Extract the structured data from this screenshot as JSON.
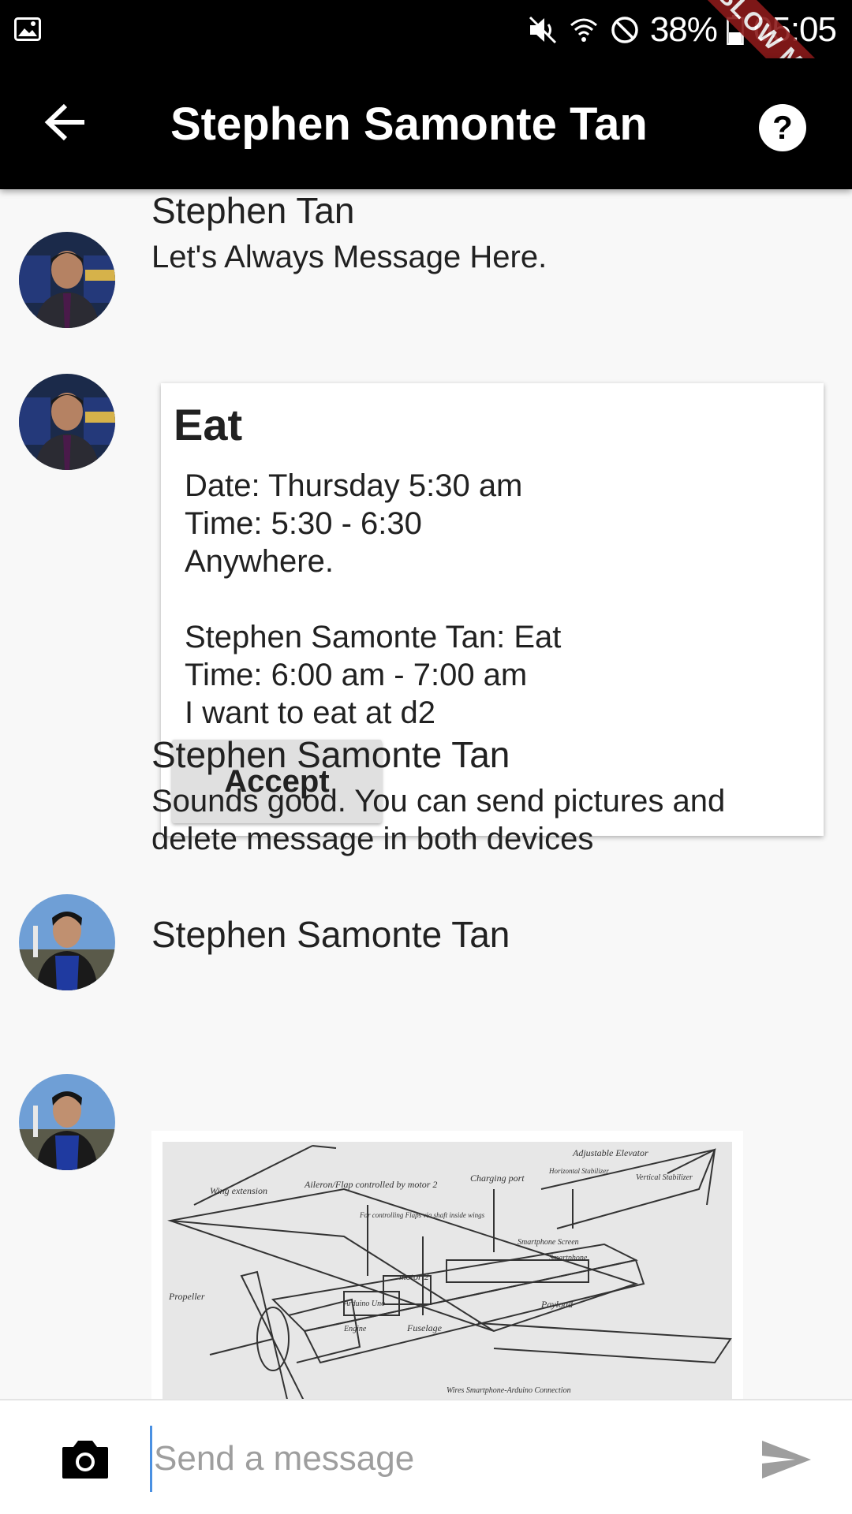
{
  "status_bar": {
    "battery": "38%",
    "time": "05:05",
    "ribbon": "SLOW MODE",
    "icons": [
      "image-icon",
      "mute-icon",
      "wifi-icon",
      "no-sim-icon",
      "battery-icon"
    ]
  },
  "app_bar": {
    "title": "Stephen Samonte Tan",
    "back_icon": "arrow-back-icon",
    "help_icon": "help-circle-icon"
  },
  "messages": [
    {
      "sender": "Stephen Tan",
      "text": "Let's Always Message Here."
    },
    {
      "sender": "",
      "card": {
        "title": "Eat",
        "lines": [
          "Date: Thursday 5:30 am",
          "Time: 5:30 - 6:30",
          "Anywhere.",
          "",
          "Stephen Samonte Tan: Eat",
          "Time: 6:00 am - 7:00 am",
          "I want to eat at d2"
        ],
        "button": "Accept"
      }
    },
    {
      "sender": "Stephen Samonte Tan",
      "text": "Sounds good. You can send pictures and delete message in both devices"
    },
    {
      "sender": "Stephen Samonte Tan",
      "image_labels": [
        "Wing extension",
        "Aileron/Flap controlled by motor 2",
        "Charging port",
        "Horizontal Stabilizer",
        "Adjustable Elevator",
        "Vertical Stabilizer",
        "For controlling Flaps via shaft inside wings",
        "Smartphone Screen",
        "Smartphone",
        "motor 2",
        "Propeller",
        "Arduino Uno",
        "Payload",
        "Engine",
        "Fuselage",
        "Wires Smartphone-Arduino Connection"
      ]
    }
  ],
  "input": {
    "placeholder": "Send a message",
    "value": "",
    "camera_icon": "camera-icon",
    "send_icon": "send-icon"
  },
  "colors": {
    "app_bar": "#000000",
    "background": "#f8f8f8",
    "ribbon": "#8b1a1a",
    "button": "#e0e0e0"
  }
}
